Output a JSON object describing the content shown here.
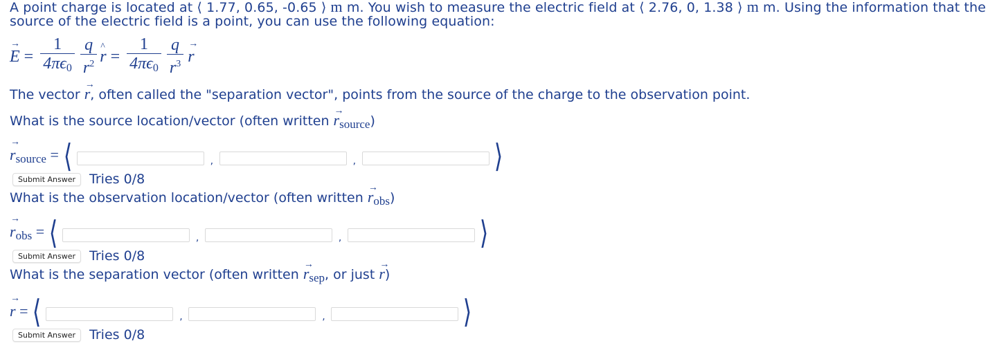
{
  "intro": {
    "part1": "A point charge is located at ",
    "source_point": "1.77, 0.65, -0.65",
    "part2": " m. You wish to measure the electric field at ",
    "obs_point": "2.76, 0, 1.38",
    "part3": " m. Using the information that the source of the electric field is a point, you can use the following equation:",
    "unit": "m"
  },
  "equation": {
    "E": "E",
    "eq": "=",
    "one": "1",
    "q": "q",
    "four_pi_eps": "4πϵ",
    "zero": "0",
    "r": "r",
    "exp2": "2",
    "exp3": "3"
  },
  "separation_text": {
    "prefix": "The vector ",
    "r": "r",
    "suffix": ", often called the \"separation vector\", points from the source of the charge to the observation point."
  },
  "questions": [
    {
      "text_prefix": "What is the source location/vector (often written ",
      "r": "r",
      "sub": "source",
      "text_suffix": ")",
      "label_sub": "source",
      "submit_label": "Submit Answer",
      "tries": "Tries 0/8"
    },
    {
      "text_prefix": "What is the observation location/vector (often written ",
      "r": "r",
      "sub": "obs",
      "text_suffix": ")",
      "label_sub": "obs",
      "submit_label": "Submit Answer",
      "tries": "Tries 0/8"
    },
    {
      "text_prefix": "What is the separation vector (often written ",
      "r": "r",
      "sub": "sep",
      "text_mid": ", or just ",
      "text_suffix": ")",
      "label_sub": "",
      "submit_label": "Submit Answer",
      "tries": "Tries 0/8"
    }
  ],
  "symbols": {
    "langle": "⟨",
    "rangle": "⟩",
    "comma": ",",
    "equals": "="
  }
}
